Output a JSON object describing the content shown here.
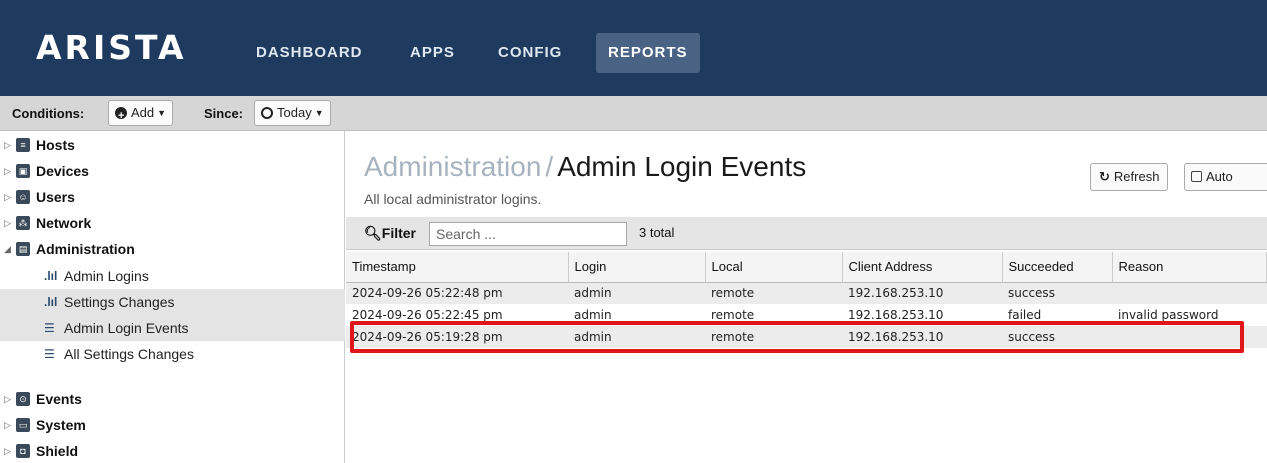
{
  "nav": {
    "logo": "ARISTA",
    "items": [
      "DASHBOARD",
      "APPS",
      "CONFIG",
      "REPORTS"
    ],
    "active": "REPORTS"
  },
  "toolbar": {
    "conditions_label": "Conditions:",
    "add_label": "Add",
    "since_label": "Since:",
    "today_label": "Today"
  },
  "sidebar": {
    "items": [
      {
        "label": "Hosts",
        "icon": "hosts-icon"
      },
      {
        "label": "Devices",
        "icon": "devices-icon"
      },
      {
        "label": "Users",
        "icon": "users-icon"
      },
      {
        "label": "Network",
        "icon": "network-icon"
      },
      {
        "label": "Administration",
        "icon": "administration-icon",
        "expanded": true
      },
      {
        "label": "Events",
        "icon": "events-icon"
      },
      {
        "label": "System",
        "icon": "system-icon"
      },
      {
        "label": "Shield",
        "icon": "shield-icon"
      }
    ],
    "subitems": [
      {
        "label": "Admin Logins",
        "icon": "bar-chart-icon"
      },
      {
        "label": "Settings Changes",
        "icon": "bar-chart-icon"
      },
      {
        "label": "Admin Login Events",
        "icon": "list-icon",
        "selected": true
      },
      {
        "label": "All Settings Changes",
        "icon": "list-icon"
      }
    ]
  },
  "main": {
    "breadcrumb_parent": "Administration",
    "breadcrumb_sep": "/",
    "title": "Admin Login Events",
    "subtitle": "All local administrator logins.",
    "refresh_label": "Refresh",
    "auto_label": "Auto",
    "filter_label": "Filter",
    "search_placeholder": "Search ...",
    "total": "3 total",
    "columns": [
      "Timestamp",
      "Login",
      "Local",
      "Client Address",
      "Succeeded",
      "Reason"
    ],
    "rows": [
      [
        "2024-09-26 05:22:48 pm",
        "admin",
        "remote",
        "192.168.253.10",
        "success",
        ""
      ],
      [
        "2024-09-26 05:22:45 pm",
        "admin",
        "remote",
        "192.168.253.10",
        "failed",
        "invalid password"
      ],
      [
        "2024-09-26 05:19:28 pm",
        "admin",
        "remote",
        "192.168.253.10",
        "success",
        ""
      ]
    ]
  },
  "colors": {
    "nav_bg": "#1e3a5f",
    "highlight": "#e0161b"
  }
}
